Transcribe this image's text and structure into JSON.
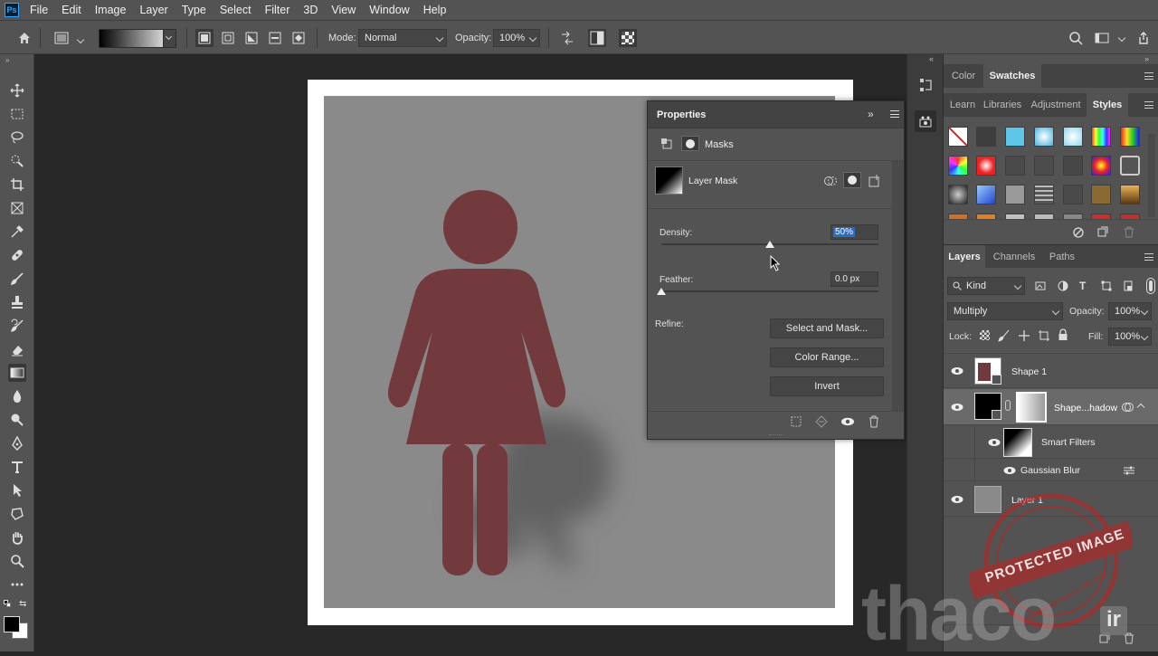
{
  "app": {
    "logo": "Ps"
  },
  "menu": [
    "File",
    "Edit",
    "Image",
    "Layer",
    "Type",
    "Select",
    "Filter",
    "3D",
    "View",
    "Window",
    "Help"
  ],
  "options": {
    "mode_label": "Mode:",
    "mode_value": "Normal",
    "opacity_label": "Opacity:",
    "opacity_value": "100%"
  },
  "properties": {
    "title": "Properties",
    "section": "Masks",
    "mask_name": "Layer Mask",
    "density_label": "Density:",
    "density_value": "50%",
    "density_level": 0.5,
    "feather_label": "Feather:",
    "feather_value": "0.0 px",
    "feather_level": 0,
    "refine_label": "Refine:",
    "buttons": {
      "select_mask": "Select and Mask...",
      "color_range": "Color Range...",
      "invert": "Invert"
    }
  },
  "panels": {
    "top_tabs": [
      "Color",
      "Swatches"
    ],
    "mid_tabs": [
      "Learn",
      "Libraries",
      "Adjustment",
      "Styles"
    ],
    "layers_tabs": [
      "Layers",
      "Channels",
      "Paths"
    ]
  },
  "layers_panel": {
    "filter_kind": "Kind",
    "blend_mode": "Multiply",
    "opacity_label": "Opacity:",
    "opacity_value": "100%",
    "lock_label": "Lock:",
    "fill_label": "Fill:",
    "fill_value": "100%",
    "layers": {
      "shape1": "Shape 1",
      "shadow": "Shape...hadow",
      "smart_filters": "Smart Filters",
      "gaussian": "Gaussian Blur",
      "layer1": "Layer 1"
    }
  },
  "watermark": {
    "stamp": "PROTECTED IMAGE",
    "stamp_small": "My Website Name & URL Here",
    "brand": "thaco",
    "brand2": "ir"
  },
  "colors": {
    "figure": "#733a3d",
    "background_gray": "#8a8a8a",
    "ui": "#535353"
  },
  "icons": [
    "home-icon",
    "gradient-icon",
    "move-icon",
    "marquee-icon",
    "lasso-icon",
    "quick-select-icon",
    "crop-icon",
    "frame-icon",
    "eyedropper-icon",
    "healing-icon",
    "brush-icon",
    "stamp-icon",
    "history-brush-icon",
    "eraser-icon",
    "gradient-tool-icon",
    "blur-icon",
    "dodge-icon",
    "pen-icon",
    "type-icon",
    "path-select-icon",
    "shape-icon",
    "hand-icon",
    "zoom-icon",
    "more-icon",
    "search-icon",
    "share-icon",
    "eye-icon"
  ]
}
